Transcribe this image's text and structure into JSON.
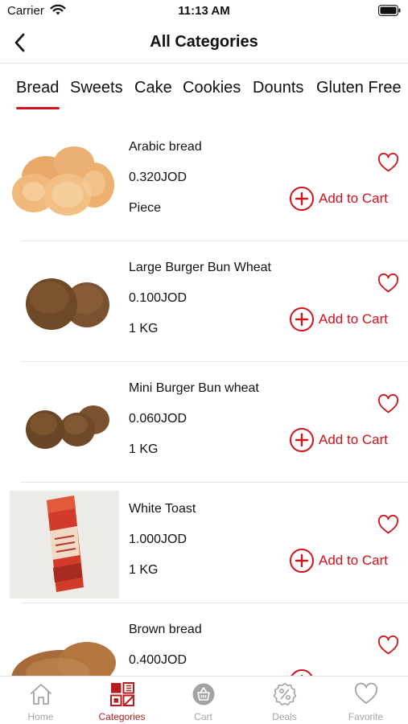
{
  "status_bar": {
    "carrier": "Carrier",
    "time": "11:13 AM"
  },
  "header": {
    "title": "All Categories"
  },
  "category_tabs": [
    {
      "label": "Bread",
      "selected": true
    },
    {
      "label": "Sweets",
      "selected": false
    },
    {
      "label": "Cake",
      "selected": false
    },
    {
      "label": "Cookies",
      "selected": false
    },
    {
      "label": "Dounts",
      "selected": false
    },
    {
      "label": "Gluten Free",
      "selected": false
    }
  ],
  "products": [
    {
      "name": "Arabic bread",
      "price": "0.320JOD",
      "unit": "Piece",
      "add_label": "Add to Cart",
      "image": "pita-bread",
      "favorite": false
    },
    {
      "name": "Large Burger Bun Wheat",
      "price": "0.100JOD",
      "unit": "1 KG",
      "add_label": "Add to Cart",
      "image": "burger-buns-two",
      "favorite": false
    },
    {
      "name": "Mini Burger Bun wheat",
      "price": "0.060JOD",
      "unit": "1 KG",
      "add_label": "Add to Cart",
      "image": "mini-buns-three",
      "favorite": false
    },
    {
      "name": "White Toast",
      "price": "1.000JOD",
      "unit": "1 KG",
      "add_label": "Add to Cart",
      "image": "toast-pack",
      "favorite": false
    },
    {
      "name": "Brown bread",
      "price": "0.400JOD",
      "unit": "",
      "add_label": "",
      "image": "brown-bread",
      "favorite": false
    }
  ],
  "bottom_nav": [
    {
      "label": "Home",
      "icon": "home-icon",
      "active": false
    },
    {
      "label": "Categories",
      "icon": "categories-grid-icon",
      "active": true
    },
    {
      "label": "Cart",
      "icon": "cart-basket-icon",
      "active": false
    },
    {
      "label": "Deals",
      "icon": "percent-badge-icon",
      "active": false
    },
    {
      "label": "Favorite",
      "icon": "heart-icon",
      "active": false
    }
  ],
  "colors": {
    "accent": "#d0121b",
    "active_nav": "#b71c1c",
    "inactive_nav": "#a3a3a3",
    "divider": "#e6e6e6"
  }
}
